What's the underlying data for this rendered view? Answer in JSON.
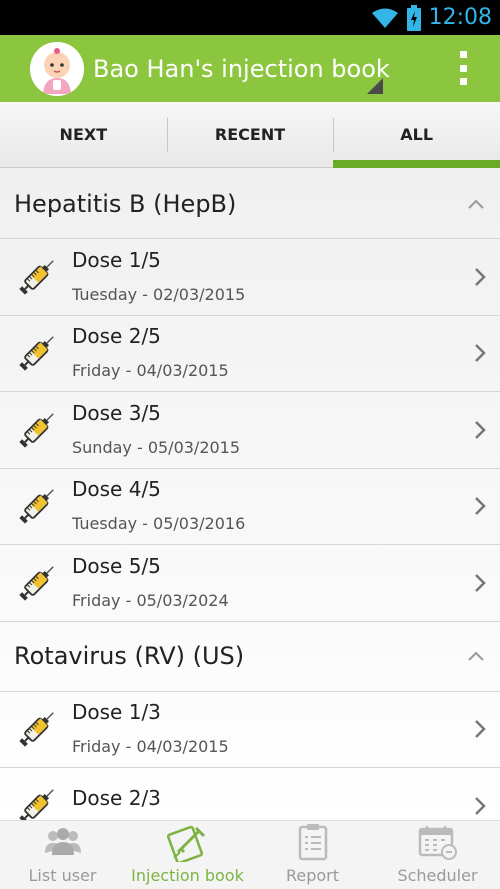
{
  "status_bar": {
    "time": "12:08"
  },
  "app_bar": {
    "title": "Bao Han's injection book"
  },
  "tabs": [
    {
      "label": "NEXT"
    },
    {
      "label": "RECENT"
    },
    {
      "label": "ALL"
    }
  ],
  "groups": [
    {
      "title": "Hepatitis B (HepB)",
      "doses": [
        {
          "label": "Dose 1/5",
          "date": "Tuesday - 02/03/2015"
        },
        {
          "label": "Dose 2/5",
          "date": "Friday - 04/03/2015"
        },
        {
          "label": "Dose 3/5",
          "date": "Sunday - 05/03/2015"
        },
        {
          "label": "Dose 4/5",
          "date": "Tuesday - 05/03/2016"
        },
        {
          "label": "Dose 5/5",
          "date": "Friday - 05/03/2024"
        }
      ]
    },
    {
      "title": "Rotavirus (RV) (US)",
      "doses": [
        {
          "label": "Dose 1/3",
          "date": "Friday - 04/03/2015"
        },
        {
          "label": "Dose 2/3",
          "date": ""
        }
      ]
    }
  ],
  "bottom_nav": [
    {
      "label": "List user",
      "icon": "users-icon"
    },
    {
      "label": "Injection book",
      "icon": "injection-book-icon"
    },
    {
      "label": "Report",
      "icon": "report-clipboard-icon"
    },
    {
      "label": "Scheduler",
      "icon": "calendar-icon"
    }
  ],
  "colors": {
    "accent": "#8cc63f",
    "tab_indicator": "#6aab25",
    "status_text": "#33b5e5"
  }
}
